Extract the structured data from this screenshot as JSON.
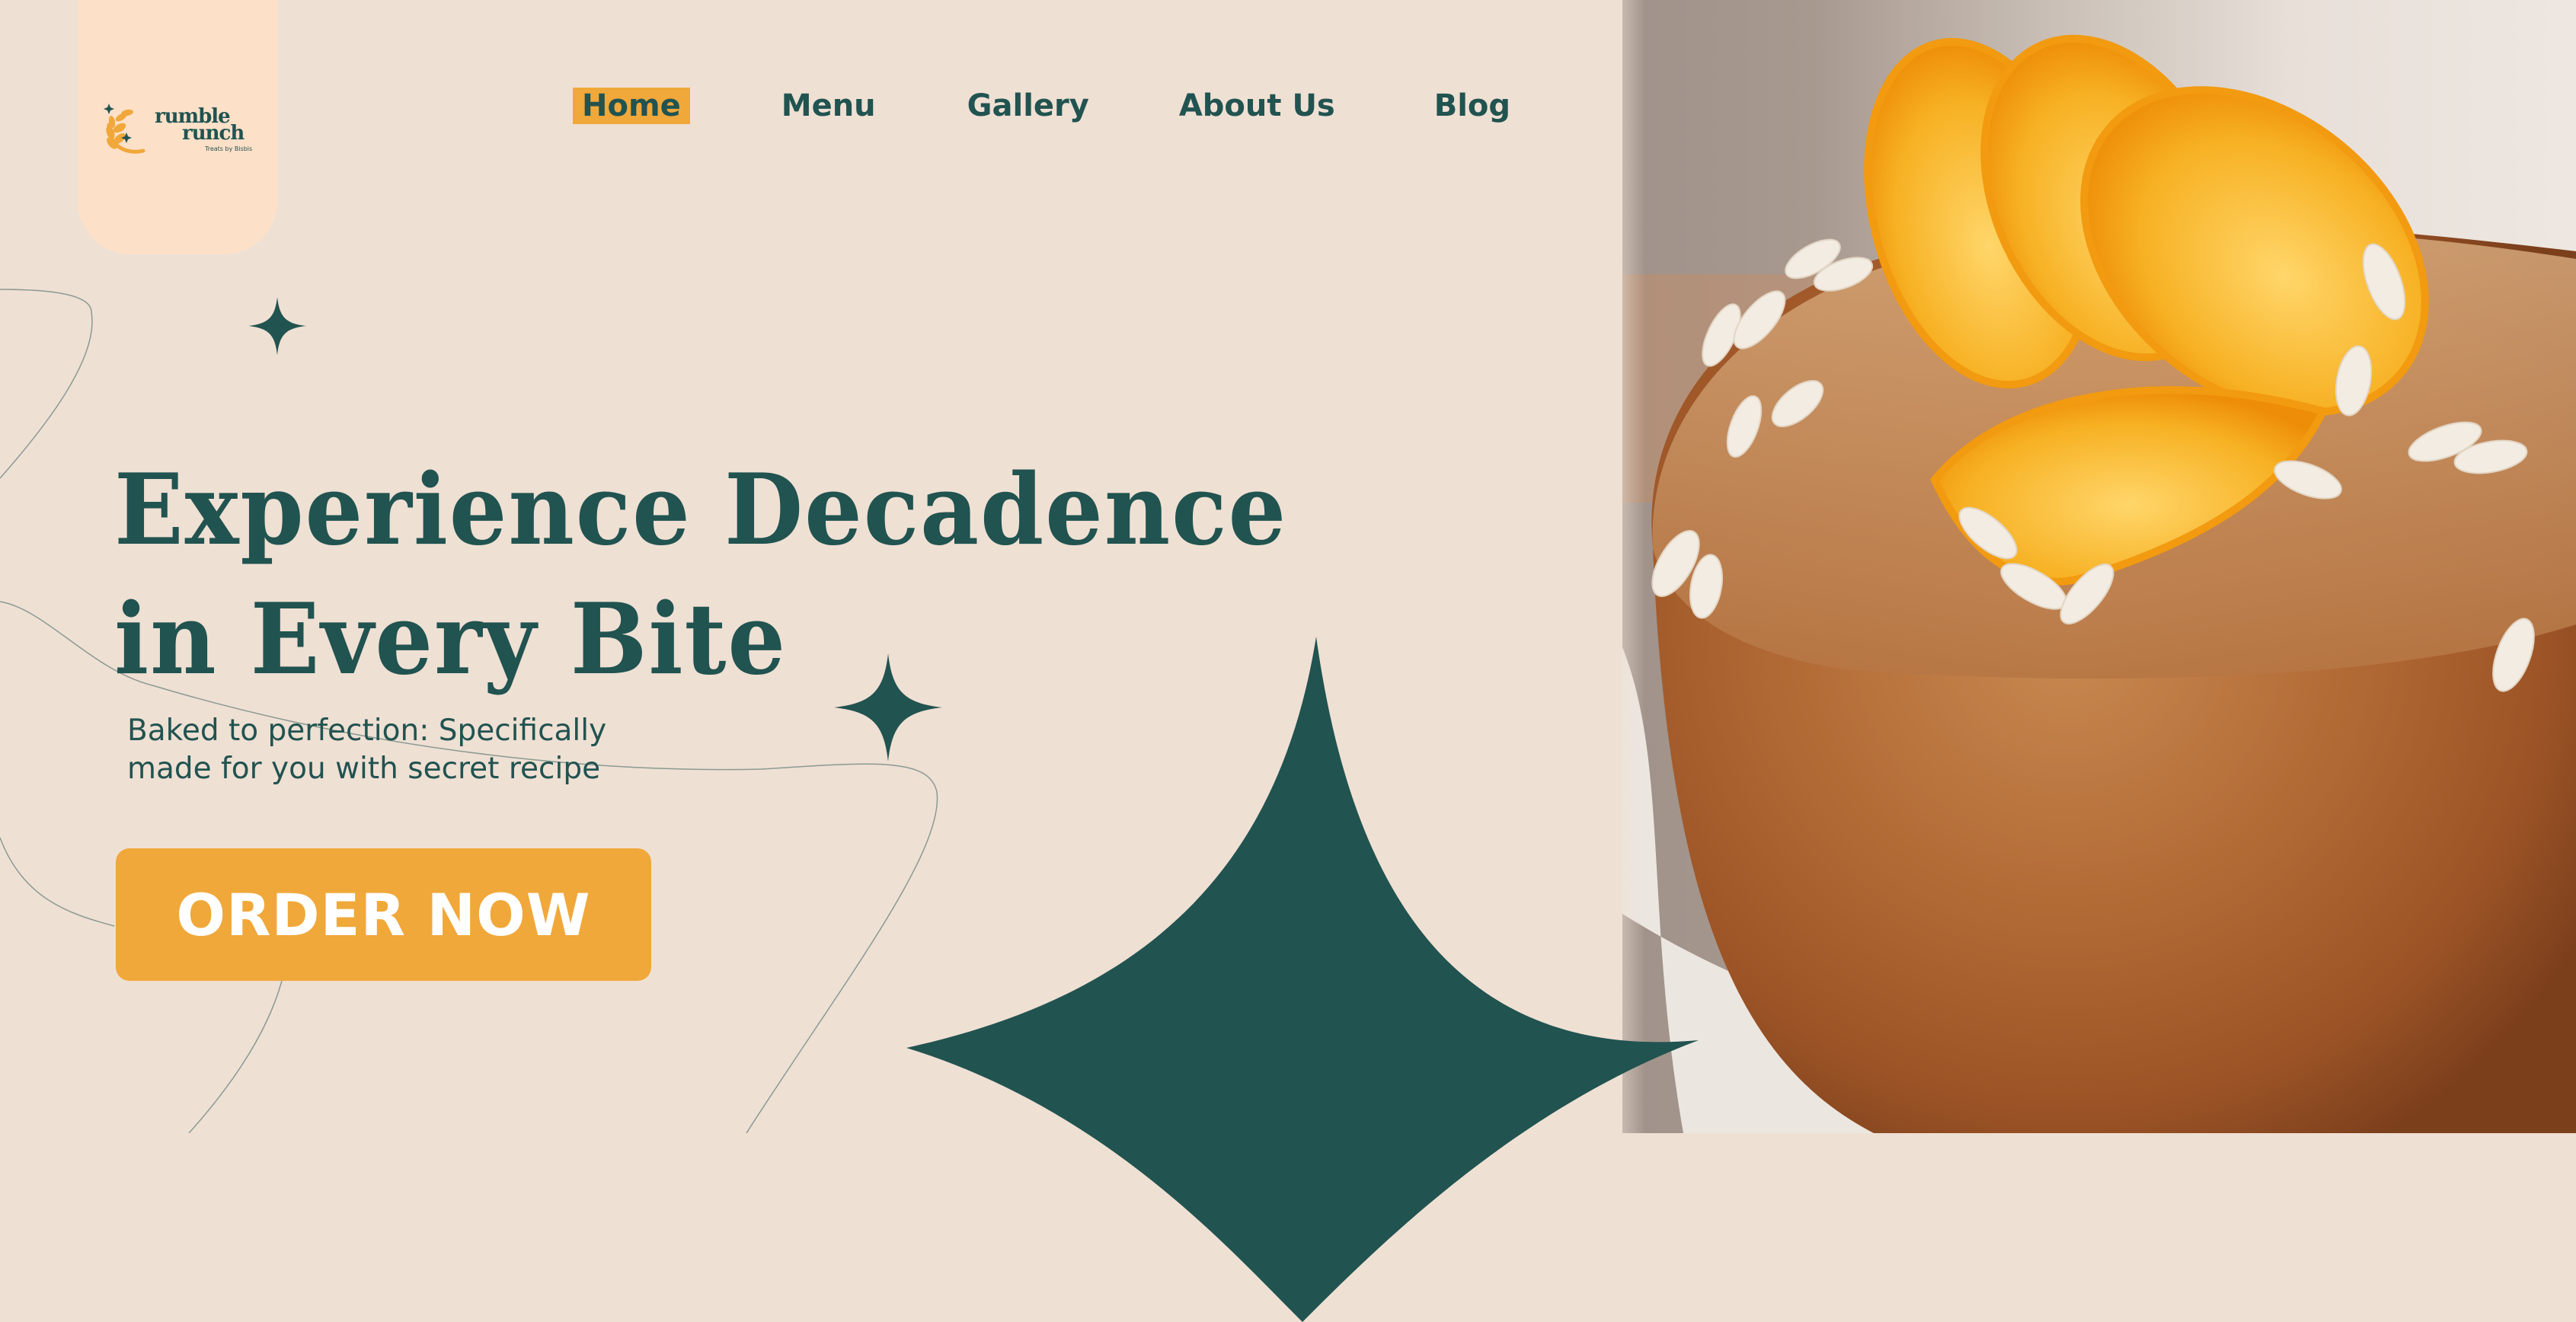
{
  "brand": {
    "name_line1": "rumble",
    "name_line2": "runch",
    "tagline": "Treats by Bisbis",
    "logo_icon": "wheat-crescent-icon"
  },
  "nav": {
    "items": [
      {
        "label": "Home",
        "active": true
      },
      {
        "label": "Menu",
        "active": false
      },
      {
        "label": "Gallery",
        "active": false
      },
      {
        "label": "About Us",
        "active": false
      },
      {
        "label": "Blog",
        "active": false
      }
    ]
  },
  "hero": {
    "headline_line1": "Experience Decadence",
    "headline_line2": "in Every Bite",
    "subtext_line1": "Baked to perfection: Specifically",
    "subtext_line2": "made for you with secret recipe",
    "cta_label": "ORDER NOW",
    "image_alt": "Orange almond bundt cake topped with orange slices and sliced almonds"
  },
  "decor": {
    "star_icon": "four-point-star-icon"
  },
  "colors": {
    "background": "#efe0d4",
    "logo_card": "#fde0c8",
    "primary": "#215350",
    "accent": "#f0a83a",
    "cta_text": "#ffffff"
  }
}
